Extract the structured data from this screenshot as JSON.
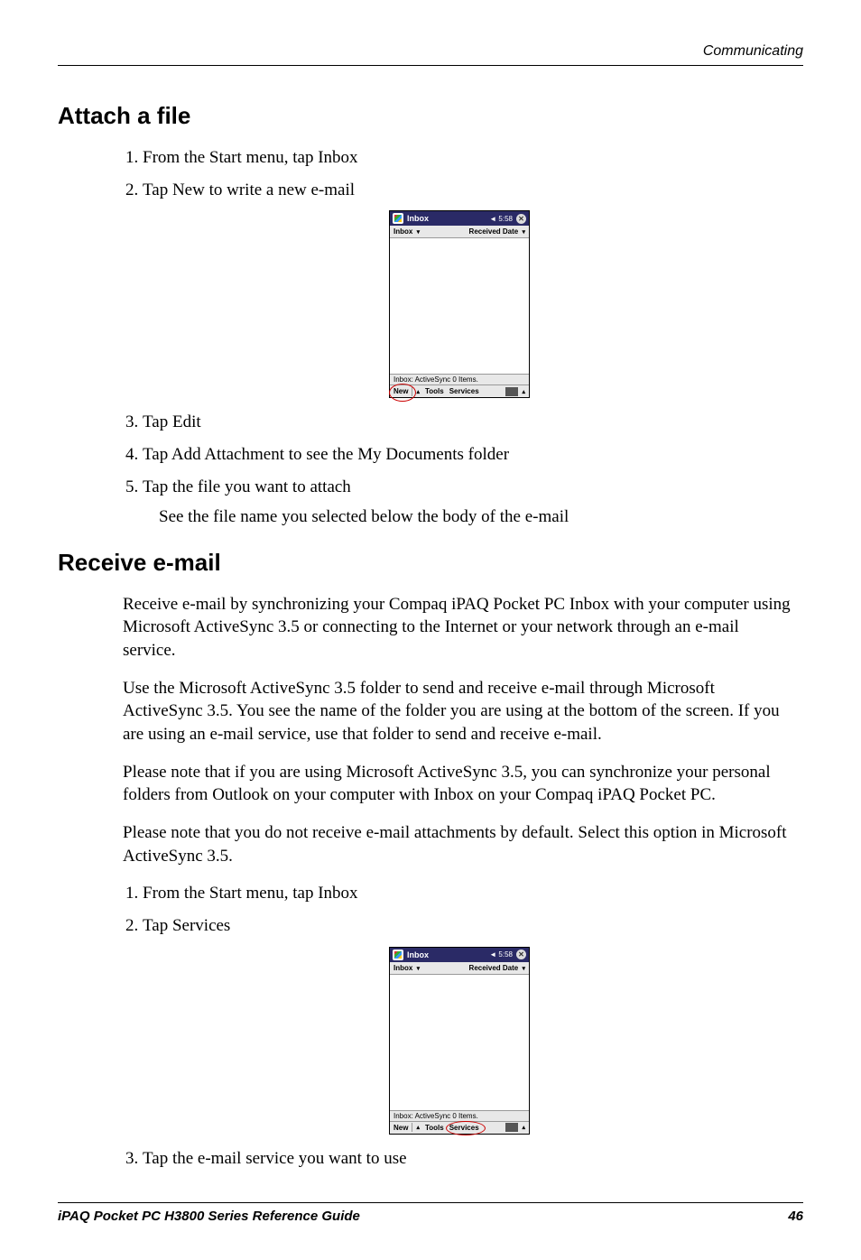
{
  "header": {
    "running_head": "Communicating"
  },
  "sections": {
    "attach": {
      "title": "Attach a file",
      "steps": {
        "s1": "From the Start menu, tap Inbox",
        "s2": "Tap New to write a new e-mail",
        "s3": "Tap Edit",
        "s4": "Tap Add Attachment to see the My Documents folder",
        "s5": "Tap the file you want to attach",
        "s5_sub": "See the file name you selected below the body of the e-mail"
      }
    },
    "receive": {
      "title": "Receive e-mail",
      "p1": "Receive e-mail by synchronizing your Compaq iPAQ Pocket PC Inbox with your computer using Microsoft ActiveSync 3.5 or connecting to the Internet or your network through an e-mail service.",
      "p2": "Use the Microsoft ActiveSync 3.5 folder to send and receive e-mail through Microsoft ActiveSync 3.5. You see the name of the folder you are using at the bottom of the screen. If you are using an e-mail service, use that folder to send and receive e-mail.",
      "p3": "Please note that if you are using Microsoft ActiveSync 3.5, you can synchronize your personal folders from Outlook on your computer with Inbox on your Compaq iPAQ Pocket PC.",
      "p4": "Please note that you do not receive e-mail attachments by default. Select this option in Microsoft ActiveSync 3.5.",
      "steps": {
        "s1": "From the Start menu, tap Inbox",
        "s2": "Tap Services",
        "s3": "Tap the e-mail service you want to use"
      }
    }
  },
  "screenshot": {
    "app_title": "Inbox",
    "time": "◄ 5:58",
    "close": "✕",
    "folder_label": "Inbox",
    "sort_label": "Received Date",
    "dropdown_arrow": "▾",
    "status": "Inbox: ActiveSync  0 Items.",
    "menu": {
      "new": "New",
      "tools": "Tools",
      "services": "Services",
      "up": "▴"
    }
  },
  "footer": {
    "doc_title": "iPAQ Pocket PC H3800 Series Reference Guide",
    "page": "46"
  }
}
